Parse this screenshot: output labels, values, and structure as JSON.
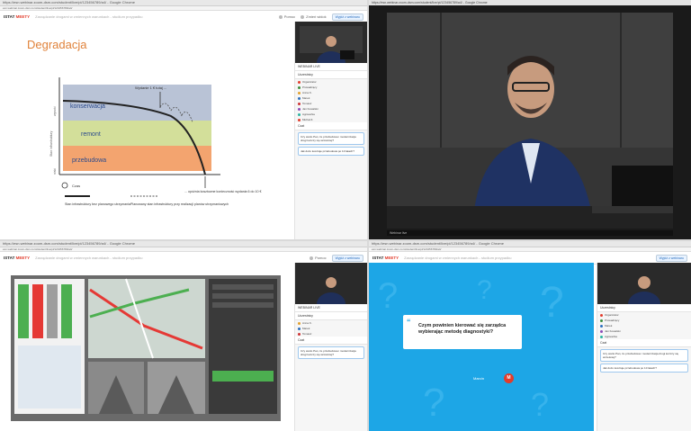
{
  "browser": {
    "tab_title": "https://esn.webinar.zoom-dsm.com/student/live/pl/123456789/a4/ - Google Chrome",
    "url": "esn.webinar.zoom-dsm.com/student/live/pl/123456789/a4/"
  },
  "app": {
    "logo_left": "ISTAT",
    "logo_right": "MEETY",
    "breadcrumb": "Zarządzanie drogami w zmiennych warunkach - studium przypadku",
    "help": "Pomoc",
    "switch_view": "Zmień widok",
    "user_button": "Wyjdź z webinaru"
  },
  "slide": {
    "title": "Degradacja",
    "first_issue": "Wydanie 1 € tutaj ...",
    "zone_top": "konserwacja",
    "zone_mid": "remont",
    "zone_bottom": "przebudowa",
    "y_axis_top": "wysoki",
    "y_axis_mid": "Stan infrastruktury",
    "y_axis_bottom": "niski",
    "time_label": "Czas",
    "late_issue": "... opóźnia kosztowne konieczność wydania 6 do 10 €",
    "legend_unplanned": "Stan infrastruktury bez planowego utrzymania",
    "legend_planned": "Planowany stan infrastruktury przy realizacji planów utrzymaniowych"
  },
  "sidebar": {
    "video_label": "WEBINAR LIVE",
    "participants_header": "Uczestnicy",
    "participants": [
      "Organizator",
      "Prowadzący",
      "Anna K.",
      "Marek",
      "Tomasz",
      "Jan Kowalski",
      "Agnieszka",
      "Michał Z."
    ],
    "chat_header": "Czat",
    "chat_messages": [
      "Czy warto Pan, że przebudowa i modernizacja drogi kończy się wcześniej?",
      "Jak dużo kosztuje przebudowa po 10 latach?"
    ]
  },
  "video_window": {
    "title": "https://esn.webinar.zoom-dsm.com/student/live/pl/123456789/a4/ - Google Chrome",
    "footer": "Webinar live"
  },
  "question_screen": {
    "question": "Czym powinien kierować się zarządca wybierając metodę diagnostyki?",
    "asker": "Marcin",
    "asker_initial": "M"
  },
  "colors": {
    "zone_konserwacja": "#b9c3d6",
    "zone_remont": "#d3df9a",
    "zone_przebudowa": "#f3a46f",
    "question_background": "#1da6e6",
    "accent_red": "#e23c2c"
  }
}
